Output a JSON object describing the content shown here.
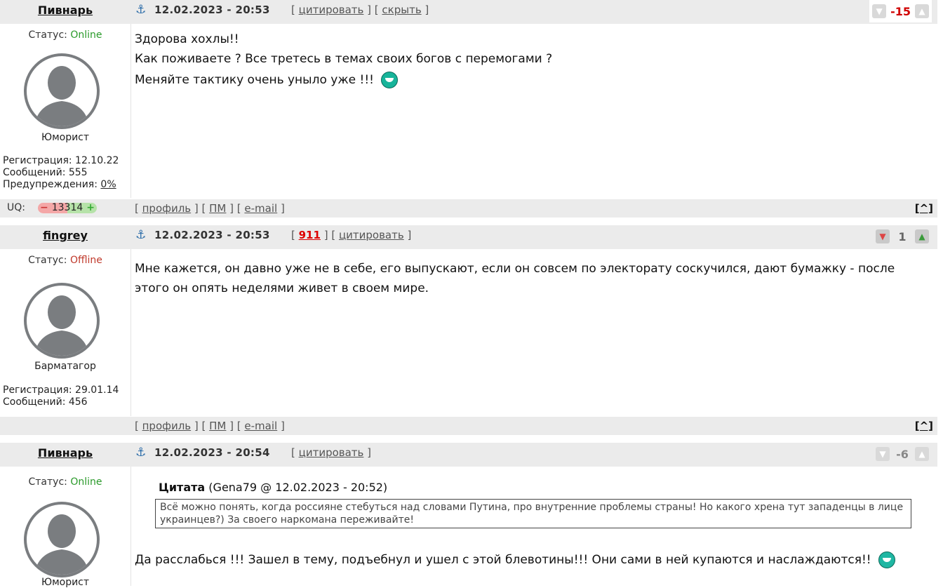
{
  "posts": [
    {
      "author": "Пивнарь",
      "datetime": "12.02.2023 - 20:53",
      "links": [
        "цитировать",
        "скрыть"
      ],
      "rating": {
        "value": "-15",
        "color": "#d00000"
      },
      "status_label": "Статус:",
      "status": "Online",
      "rank": "Юморист",
      "stats": [
        "Регистрация: 12.10.22",
        "Сообщений: 555"
      ],
      "warnings_label": "Предупреждения:",
      "warnings_value": "0%",
      "text": [
        "Здорова хохлы!!",
        "Как поживаете ? Все третесь в темах своих богов с перемогами ?",
        "Меняйте тактику очень уныло уже !!!"
      ],
      "uq_label": "UQ:",
      "uq_value": "13314"
    },
    {
      "author": "fingrey",
      "datetime": "12.02.2023 - 20:53",
      "link_num": "911",
      "links": [
        "цитировать"
      ],
      "rating": {
        "value": "1",
        "color": "#666666"
      },
      "status_label": "Статус:",
      "status": "Offline",
      "rank": "Барматагор",
      "stats": [
        "Регистрация: 29.01.14",
        "Сообщений: 456"
      ],
      "text": [
        "Мне кажется, он давно уже не в себе, его выпускают, если он совсем по электорату соскучился, дают бумажку - после этого он опять неделями живет в своем мире."
      ]
    },
    {
      "author": "Пивнарь",
      "datetime": "12.02.2023 - 20:54",
      "links": [
        "цитировать"
      ],
      "rating": {
        "value": "-6",
        "color": "#888888"
      },
      "status_label": "Статус:",
      "status": "Online",
      "rank": "Юморист",
      "quote_title": "Цитата",
      "quote_source": "(Gena79 @ 12.02.2023 - 20:52)",
      "quote_text": "Всё можно понять, когда россияне стебуться над словами Путина, про внутренние проблемы страны! Но какого хрена тут западенцы в лице украинцев?) За своего наркомана переживайте!",
      "text": [
        "Да расслабься !!! Зашел в тему, подъебнул и ушел с этой блевотины!!! Они сами в ней купаются и наслаждаются!!"
      ]
    }
  ],
  "footer_links": [
    "профиль",
    "ПМ",
    "e-mail"
  ],
  "to_top": "[^]"
}
